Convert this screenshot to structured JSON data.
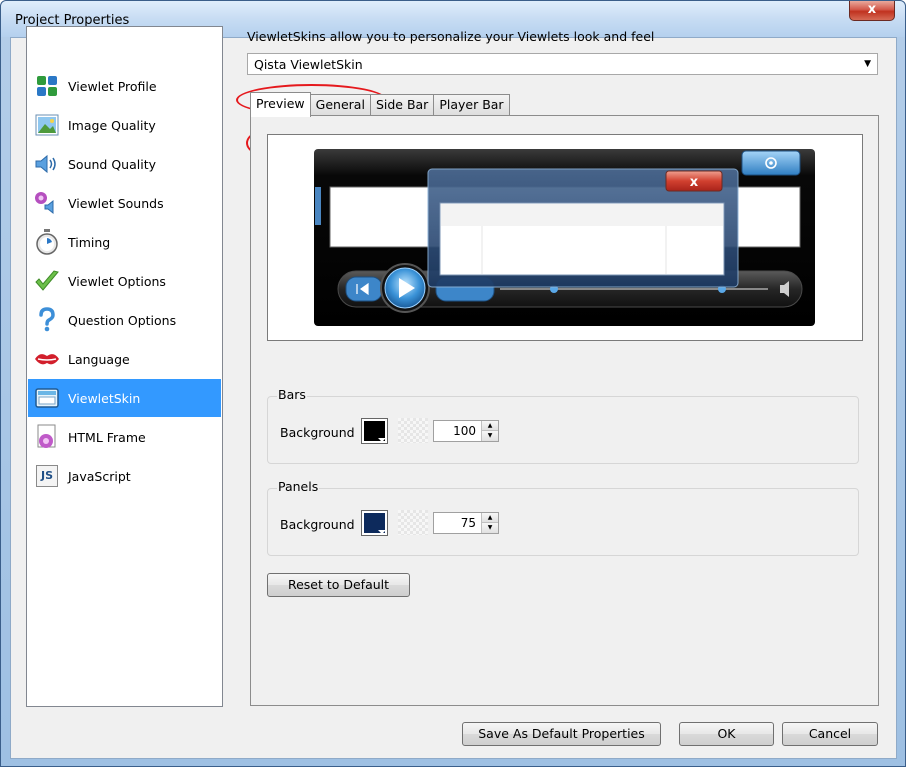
{
  "window": {
    "title": "Project Properties",
    "close_glyph": "x"
  },
  "nav": {
    "items": [
      {
        "label": "Viewlet Profile",
        "icon": "viewlet-profile-icon"
      },
      {
        "label": "Image Quality",
        "icon": "image-quality-icon"
      },
      {
        "label": "Sound Quality",
        "icon": "sound-quality-icon"
      },
      {
        "label": "Viewlet Sounds",
        "icon": "viewlet-sounds-icon"
      },
      {
        "label": "Timing",
        "icon": "timing-icon"
      },
      {
        "label": "Viewlet Options",
        "icon": "viewlet-options-icon"
      },
      {
        "label": "Question Options",
        "icon": "question-options-icon"
      },
      {
        "label": "Language",
        "icon": "language-icon"
      },
      {
        "label": "ViewletSkin",
        "icon": "viewletskin-icon",
        "selected": true
      },
      {
        "label": "HTML Frame",
        "icon": "html-frame-icon"
      },
      {
        "label": "JavaScript",
        "icon": "javascript-icon",
        "glyph": "JS"
      }
    ]
  },
  "skin": {
    "hint": "ViewletSkins allow you to personalize your Viewlets look and feel",
    "selected": "Qista ViewletSkin"
  },
  "tabs": [
    "Preview",
    "General",
    "Side Bar",
    "Player Bar"
  ],
  "preview_player": {
    "close_glyph": "x"
  },
  "bars": {
    "title": "Bars",
    "background_label": "Background",
    "color": "#000000",
    "opacity": "100"
  },
  "panels": {
    "title": "Panels",
    "background_label": "Background",
    "color": "#0d2a5c",
    "opacity": "75"
  },
  "buttons": {
    "reset": "Reset to Default",
    "save_default": "Save As Default Properties",
    "ok": "OK",
    "cancel": "Cancel"
  },
  "colors": {
    "selection": "#3399ff",
    "highlight_oval": "#e5191d"
  }
}
